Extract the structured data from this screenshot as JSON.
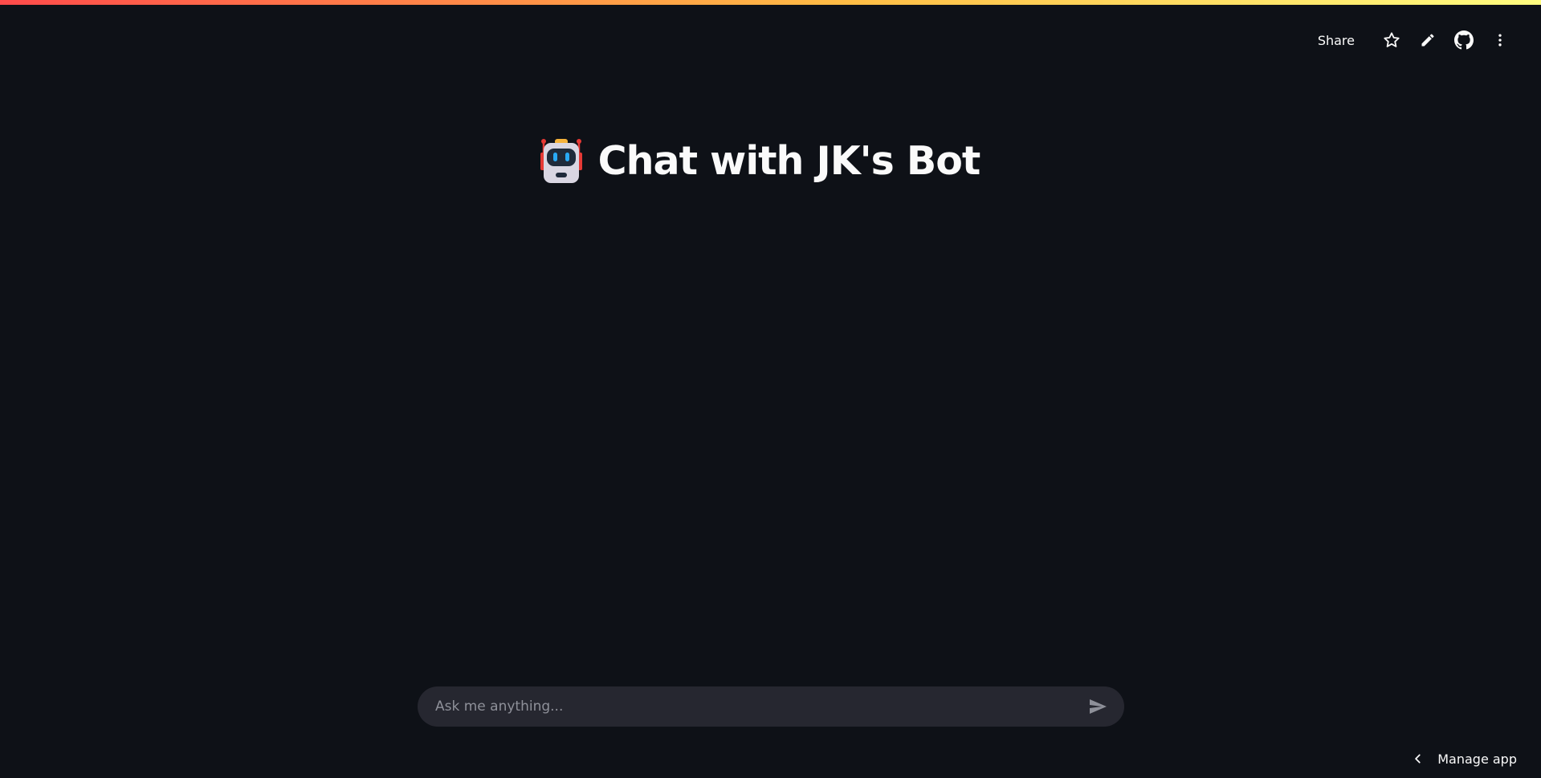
{
  "header": {
    "share_label": "Share",
    "icons": [
      "star-icon",
      "pencil-icon",
      "github-icon",
      "more-vertical-icon"
    ]
  },
  "main": {
    "title_icon": "robot-icon",
    "title": "Chat with JK's Bot"
  },
  "chat": {
    "placeholder": "Ask me anything...",
    "send_icon": "send-icon"
  },
  "footer": {
    "manage_label": "Manage app",
    "chevron_icon": "chevron-left-icon"
  },
  "colors": {
    "background": "#0e1117",
    "input_background": "#262730",
    "text": "#fafafa",
    "placeholder": "#8e9099",
    "accent_start": "#ff4b4b",
    "accent_end": "#fffd80"
  }
}
